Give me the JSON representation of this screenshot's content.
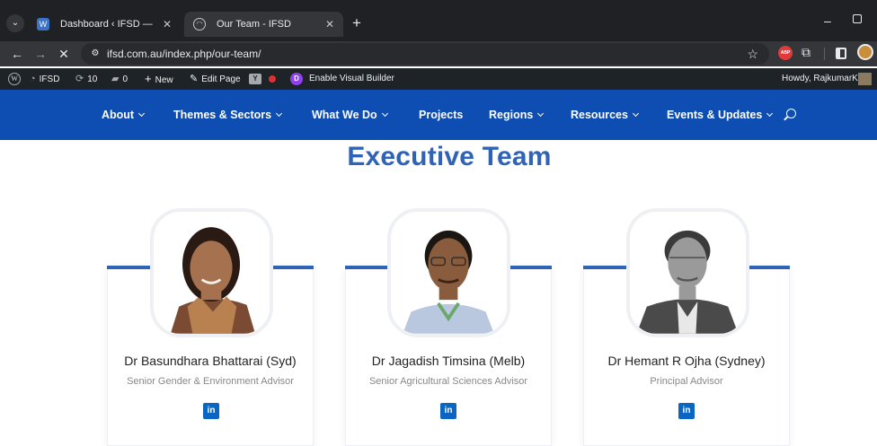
{
  "browser": {
    "tabs": [
      {
        "title": "Dashboard ‹ IFSD — WordPress",
        "active": false
      },
      {
        "title": "Our Team - IFSD",
        "active": true
      }
    ],
    "url": "ifsd.com.au/index.php/our-team/",
    "extension_abp": "ABP"
  },
  "adminbar": {
    "site": "IFSD",
    "updates": "10",
    "comments": "0",
    "new": "New",
    "edit_page": "Edit Page",
    "visual_builder": "Enable Visual Builder",
    "howdy": "Howdy, RajkumarK"
  },
  "nav": {
    "items": [
      {
        "label": "About",
        "dropdown": true
      },
      {
        "label": "Themes & Sectors",
        "dropdown": true
      },
      {
        "label": "What We Do",
        "dropdown": true
      },
      {
        "label": "Projects",
        "dropdown": false
      },
      {
        "label": "Regions",
        "dropdown": true
      },
      {
        "label": "Resources",
        "dropdown": true
      },
      {
        "label": "Events & Updates",
        "dropdown": true
      }
    ],
    "brand_color": "#0e4db2"
  },
  "page": {
    "title": "Executive Team",
    "accent_color": "#2f63b8"
  },
  "team": [
    {
      "name": "Dr Basundhara Bhattarai (Syd)",
      "role": "Senior Gender & Environment Advisor",
      "social": "in"
    },
    {
      "name": "Dr Jagadish Timsina (Melb)",
      "role": "Senior Agricultural Sciences Advisor",
      "social": "in"
    },
    {
      "name": "Dr Hemant R Ojha (Sydney)",
      "role": "Principal Advisor",
      "social": "in"
    }
  ]
}
